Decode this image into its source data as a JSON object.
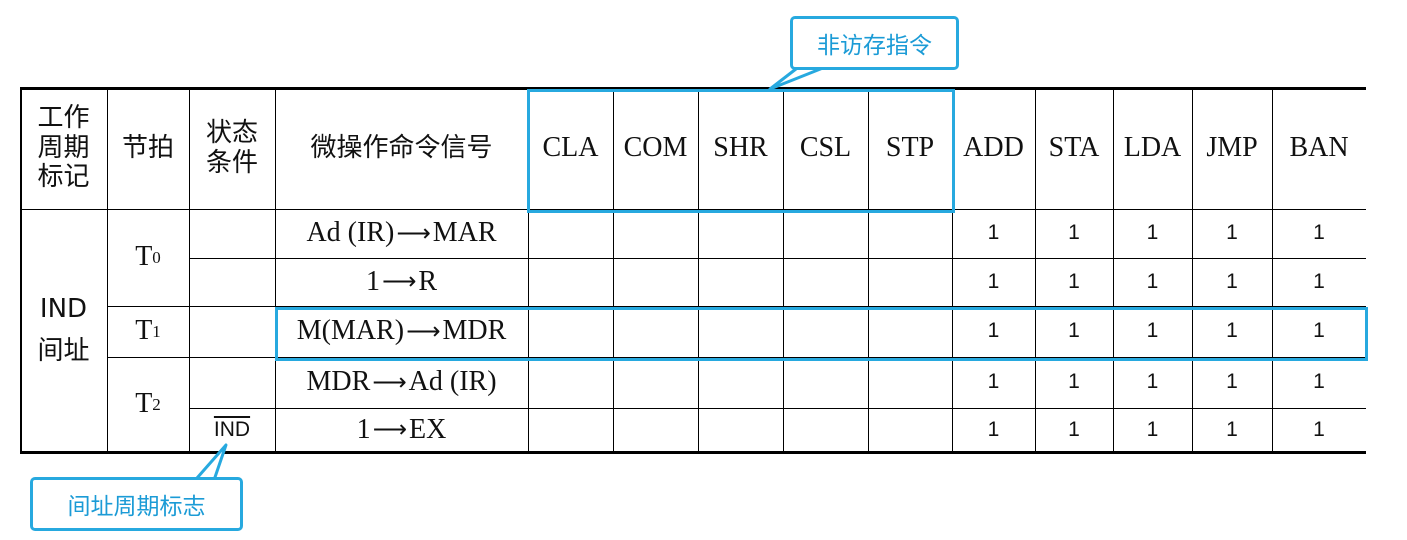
{
  "callouts": {
    "non_memory_instructions": "非访存指令",
    "indirect_cycle_flag": "间址周期标志"
  },
  "table": {
    "headers": {
      "cycle_flag": "工作\n周期\n标记",
      "beat": "节拍",
      "condition": "状态\n条件",
      "micro_ops": "微操作命令信号",
      "instructions": [
        "CLA",
        "COM",
        "SHR",
        "CSL",
        "STP",
        "ADD",
        "STA",
        "LDA",
        "JMP",
        "BAN"
      ]
    },
    "cycle_label": "IND\n间址",
    "beats": {
      "t0": {
        "base": "T",
        "sub": "0"
      },
      "t1": {
        "base": "T",
        "sub": "1"
      },
      "t2": {
        "base": "T",
        "sub": "2"
      }
    },
    "condition_flag": "IND",
    "rows": [
      {
        "left": "Ad (IR)",
        "right": "MAR",
        "values": [
          "",
          "",
          "",
          "",
          "",
          "1",
          "1",
          "1",
          "1",
          "1"
        ]
      },
      {
        "left": "1",
        "right": "R",
        "values": [
          "",
          "",
          "",
          "",
          "",
          "1",
          "1",
          "1",
          "1",
          "1"
        ]
      },
      {
        "left": "M(MAR)",
        "right": "MDR",
        "values": [
          "",
          "",
          "",
          "",
          "",
          "1",
          "1",
          "1",
          "1",
          "1"
        ]
      },
      {
        "left": "MDR",
        "right": "Ad (IR)",
        "values": [
          "",
          "",
          "",
          "",
          "",
          "1",
          "1",
          "1",
          "1",
          "1"
        ]
      },
      {
        "left": "1",
        "right": "EX",
        "values": [
          "",
          "",
          "",
          "",
          "",
          "1",
          "1",
          "1",
          "1",
          "1"
        ]
      }
    ],
    "arrow_glyph": "⟶"
  },
  "colors": {
    "accent": "#27a9df",
    "callout_text": "#1b9bd6",
    "grid": "#000000"
  }
}
